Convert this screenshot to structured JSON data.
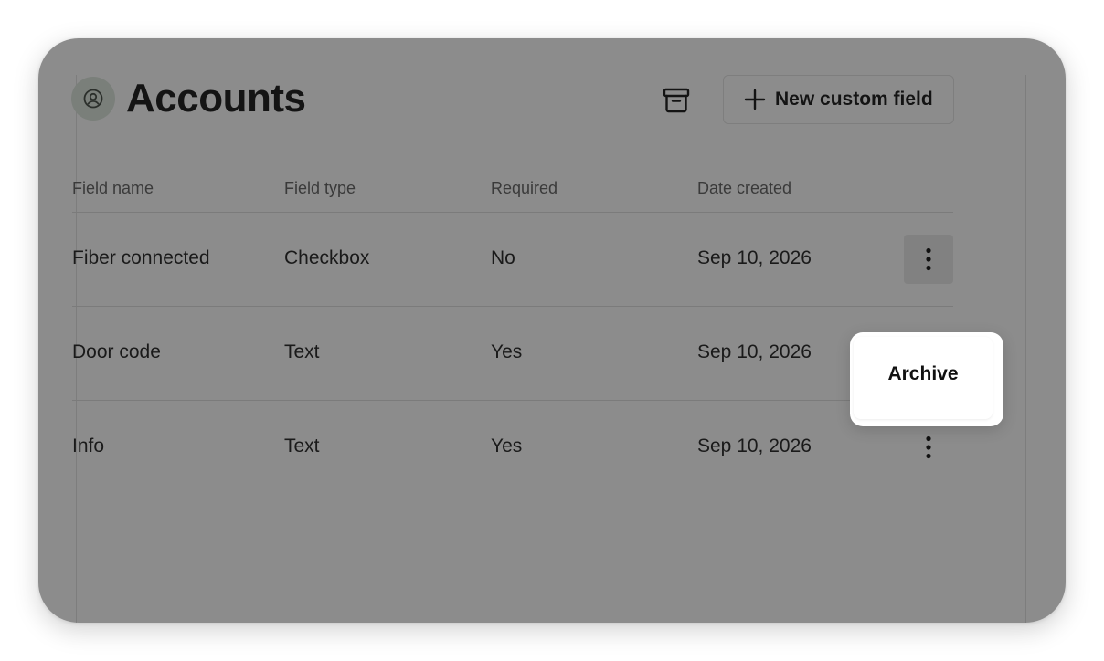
{
  "page": {
    "title": "Accounts",
    "new_field_label": "New custom field"
  },
  "table": {
    "headers": [
      "Field name",
      "Field type",
      "Required",
      "Date created"
    ],
    "rows": [
      {
        "name": "Fiber connected",
        "type": "Checkbox",
        "required": "No",
        "date": "Sep 10, 2026"
      },
      {
        "name": "Door code",
        "type": "Text",
        "required": "Yes",
        "date": "Sep 10, 2026"
      },
      {
        "name": "Info",
        "type": "Text",
        "required": "Yes",
        "date": "Sep 10, 2026"
      }
    ]
  },
  "menu": {
    "archive_label": "Archive"
  },
  "icons": {
    "avatar": "user-circle-icon",
    "archive": "archive-box-icon",
    "add": "plus-icon",
    "more": "more-vertical-icon"
  },
  "colors": {
    "overlay": "#8c8c8c",
    "menu_bg": "#ffffff",
    "text": "#141414"
  }
}
